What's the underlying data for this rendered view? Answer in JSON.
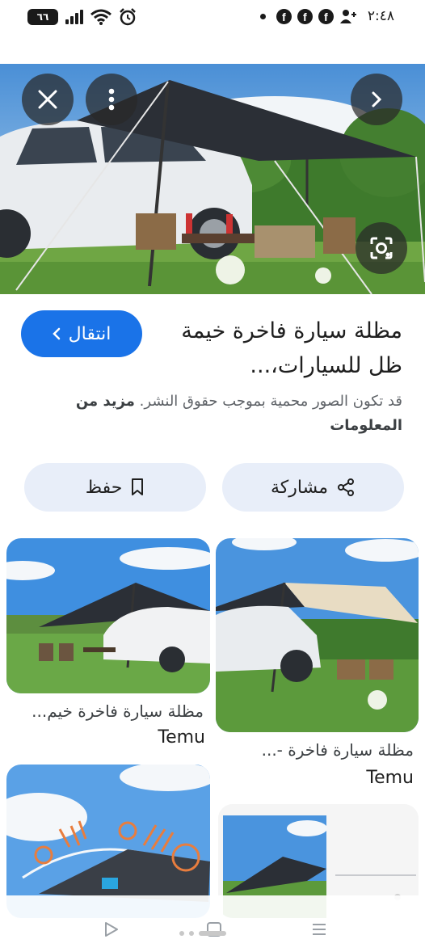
{
  "status_bar": {
    "time": "٢:٤٨",
    "battery": "٦٦",
    "notif_icons": [
      "facebook-icon",
      "facebook-icon",
      "facebook-icon",
      "add-person-icon"
    ]
  },
  "hero": {
    "icons": [
      "close-icon",
      "more-vert-icon",
      "chevron-right-icon",
      "lens-icon"
    ]
  },
  "result": {
    "title": "مظلة سيارة فاخرة خيمة ظل للسيارات،...",
    "goto_label": "انتقال",
    "notice_text": "قد تكون الصور محمية بموجب حقوق النشر.",
    "notice_link": "مزيد من المعلومات"
  },
  "actions": {
    "share_label": "مشاركة",
    "save_label": "حفظ"
  },
  "grid": [
    {
      "caption": "مظلة سيارة فاخرة خيم...",
      "source": "Temu"
    },
    {
      "caption": "مظلة سيارة فاخرة -...",
      "source": "Temu"
    }
  ],
  "colors": {
    "accent": "#1a73e8",
    "pill_bg": "#e8eef9",
    "tent_dark": "#2b2f36",
    "tent_beige": "#e8dcc3"
  }
}
